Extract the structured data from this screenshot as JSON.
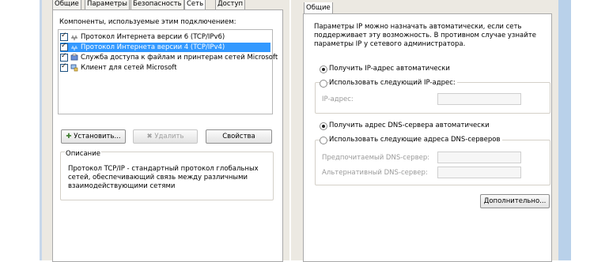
{
  "left": {
    "tabs": [
      "Общие",
      "Параметры",
      "Безопасность",
      "Сеть",
      "Доступ"
    ],
    "active_tab": "Сеть",
    "components_label": "Компоненты, используемые этим подключением:",
    "components": [
      {
        "label": "Протокол Интернета версии 6 (TCP/IPv6)",
        "checked": true,
        "icon": "protocol-icon"
      },
      {
        "label": "Протокол Интернета версии 4 (TCP/IPv4)",
        "checked": true,
        "icon": "protocol-icon",
        "selected": true
      },
      {
        "label": "Служба доступа к файлам и принтерам сетей Microsoft",
        "checked": true,
        "icon": "file-printer-sharing-icon"
      },
      {
        "label": "Клиент для сетей Microsoft",
        "checked": true,
        "icon": "network-client-icon"
      }
    ],
    "buttons": {
      "install": "Установить...",
      "remove": "Удалить",
      "properties": "Свойства"
    },
    "description": {
      "title": "Описание",
      "lines": [
        "Протокол TCP/IP - стандартный протокол глобальных",
        "сетей, обеспечивающий связь между различными",
        "взаимодействующими сетями"
      ]
    }
  },
  "right": {
    "tabs": [
      "Общие"
    ],
    "intro_lines": [
      "Параметры IP можно назначать автоматически, если сеть",
      "поддерживает эту возможность. В противном случае узнайте",
      "параметры IP у сетевого администратора."
    ],
    "ip": {
      "auto_label": "Получить IP-адрес автоматически",
      "manual_label": "Использовать следующий IP-адрес:",
      "address_label": "IP-адрес:",
      "auto_selected": true
    },
    "dns": {
      "auto_label": "Получить адрес DNS-сервера автоматически",
      "manual_label": "Использовать следующие адреса DNS-серверов",
      "preferred_label": "Предпочитаемый DNS-сервер:",
      "alternate_label": "Альтернативный DNS-сервер:",
      "auto_selected": true
    },
    "advanced_button": "Дополнительно..."
  }
}
